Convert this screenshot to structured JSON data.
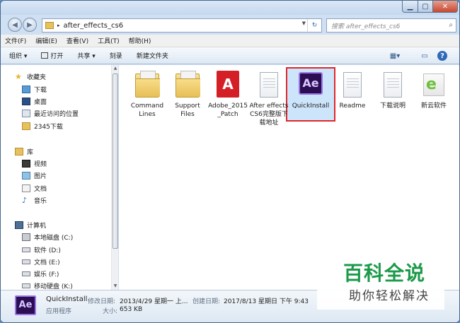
{
  "window": {
    "min": "▁",
    "max": "▢",
    "close": "✕"
  },
  "address": {
    "path": "after_effects_cs6",
    "refresh": "↻",
    "back_icon": "◀",
    "fwd_icon": "▶"
  },
  "search": {
    "placeholder": "搜索 after_effects_cs6",
    "icon": "search-icon"
  },
  "menu": [
    "文件(F)",
    "编辑(E)",
    "查看(V)",
    "工具(T)",
    "帮助(H)"
  ],
  "toolbar": {
    "organize": "组织 ▾",
    "open": "打开",
    "share": "共享 ▾",
    "burn": "刻录",
    "new_folder": "新建文件夹"
  },
  "sidebar": {
    "favorites": {
      "label": "收藏夹",
      "items": [
        "下载",
        "桌面",
        "最近访问的位置",
        "2345下载"
      ]
    },
    "libraries": {
      "label": "库",
      "items": [
        "视频",
        "图片",
        "文档",
        "音乐"
      ]
    },
    "computer": {
      "label": "计算机",
      "items": [
        "本地磁盘 (C:)",
        "软件 (D:)",
        "文档 (E:)",
        "娱乐 (F:)",
        "移动硬盘 (K:)"
      ]
    }
  },
  "files": [
    {
      "name": "Command Lines",
      "icon": "folder-icon"
    },
    {
      "name": "Support Files",
      "icon": "folder-icon"
    },
    {
      "name": "Adobe_2015_Patch",
      "icon": "adobe-icon"
    },
    {
      "name": "After effects CS6完整版下载地址",
      "icon": "document-icon"
    },
    {
      "name": "QuickInstall",
      "icon": "after-effects-icon",
      "selected": true
    },
    {
      "name": "Readme",
      "icon": "document-icon"
    },
    {
      "name": "下载说明",
      "icon": "document-icon"
    },
    {
      "name": "新云软件",
      "icon": "ie-icon"
    }
  ],
  "status": {
    "name": "QuickInstall",
    "type": "应用程序",
    "modified_label": "修改日期:",
    "modified": "2013/4/29 星期一 上...",
    "created_label": "创建日期:",
    "created": "2017/8/13 星期日 下午 9:43",
    "size_label": "大小:",
    "size": "653 KB"
  },
  "watermark": {
    "title": "百科全说",
    "subtitle": "助你轻松解决"
  },
  "colors": {
    "accent": "#e0262a",
    "ae": "#2a0d52",
    "watermark": "#1c9a4a"
  }
}
